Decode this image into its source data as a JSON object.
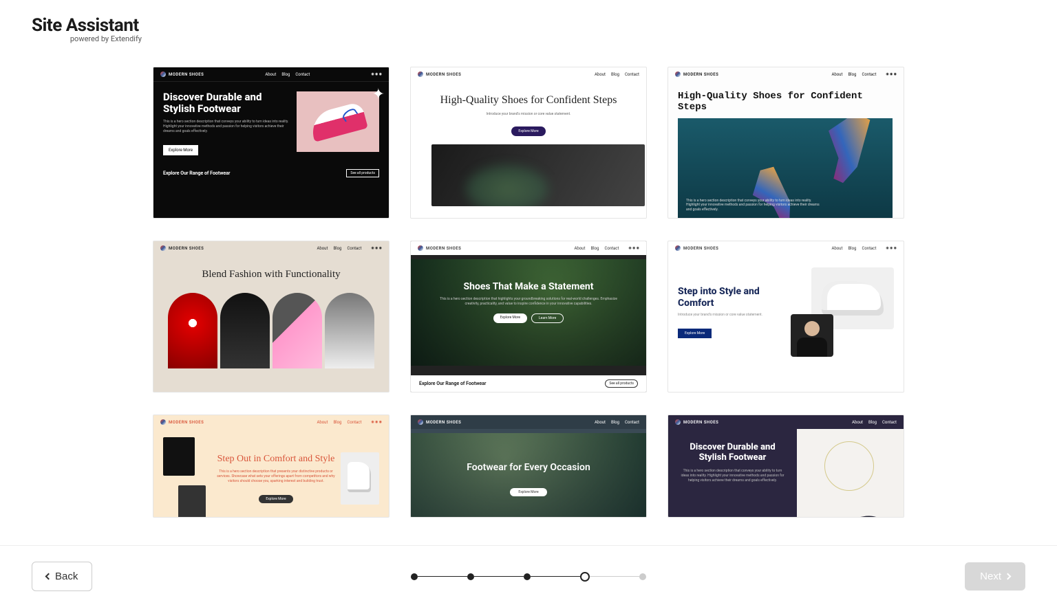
{
  "app": {
    "title": "Site Assistant",
    "subtitle": "powered by Extendify"
  },
  "common": {
    "brand": "MODERN SHOES",
    "nav": {
      "about": "About",
      "blog": "Blog",
      "contact": "Contact"
    }
  },
  "cards": [
    {
      "headline": "Discover Durable and Stylish Footwear",
      "desc": "This is a hero section description that conveys your ability to turn ideas into reality. Highlight your innovative methods and passion for helping visitors achieve their dreams and goals effectively.",
      "cta": "Explore More",
      "footer_title": "Explore Our Range of Footwear",
      "footer_cta": "See all products"
    },
    {
      "headline": "High-Quality Shoes for Confident Steps",
      "desc": "Introduce your brand's mission or core value statement.",
      "cta": "Explore More"
    },
    {
      "headline": "High-Quality Shoes for Confident Steps",
      "overlay": "This is a hero section description that conveys your ability to turn ideas into reality. Highlight your innovative methods and passion for helping visitors achieve their dreams and goals effectively."
    },
    {
      "headline": "Blend Fashion with Functionality"
    },
    {
      "headline": "Shoes That Make a Statement",
      "desc": "This is a hero section description that highlights your groundbreaking solutions for real-world challenges. Emphasize creativity, practicality, and value to inspire confidence in your innovative capabilities.",
      "cta1": "Explore More",
      "cta2": "Learn More",
      "footer_title": "Explore Our Range of Footwear",
      "footer_cta": "See all products"
    },
    {
      "headline": "Step into Style and Comfort",
      "desc": "Introduce your brand's mission or core value statement.",
      "cta": "Explore More"
    },
    {
      "headline": "Step Out in Comfort and Style",
      "desc": "This is a hero section description that presents your distinctive products or services. Showcase what sets your offerings apart from competitors and why visitors should choose you, sparking interest and building trust.",
      "cta": "Explore More"
    },
    {
      "headline": "Footwear for Every Occasion",
      "cta": "Explore More"
    },
    {
      "headline": "Discover Durable and Stylish Footwear",
      "desc": "This is a hero section description that conveys your ability to turn ideas into reality. Highlight your innovative methods and passion for helping visitors achieve their dreams and goals effectively."
    }
  ],
  "footer": {
    "back": "Back",
    "next": "Next",
    "current_step": 4,
    "total_steps": 5
  }
}
